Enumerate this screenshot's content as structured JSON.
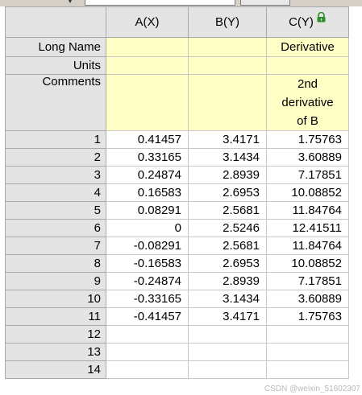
{
  "columns": [
    {
      "label": "A(X)"
    },
    {
      "label": "B(Y)"
    },
    {
      "label": "C(Y)"
    }
  ],
  "row_labels": {
    "long_name": "Long Name",
    "units": "Units",
    "comments": "Comments"
  },
  "meta": {
    "long_name": [
      "",
      "",
      "Derivative"
    ],
    "units": [
      "",
      "",
      ""
    ],
    "comments": [
      "",
      "",
      "2nd derivative of B"
    ]
  },
  "rows": [
    {
      "n": "1",
      "a": "0.41457",
      "b": "3.4171",
      "c": "1.75763"
    },
    {
      "n": "2",
      "a": "0.33165",
      "b": "3.1434",
      "c": "3.60889"
    },
    {
      "n": "3",
      "a": "0.24874",
      "b": "2.8939",
      "c": "7.17851"
    },
    {
      "n": "4",
      "a": "0.16583",
      "b": "2.6953",
      "c": "10.08852"
    },
    {
      "n": "5",
      "a": "0.08291",
      "b": "2.5681",
      "c": "11.84764"
    },
    {
      "n": "6",
      "a": "0",
      "b": "2.5246",
      "c": "12.41511"
    },
    {
      "n": "7",
      "a": "-0.08291",
      "b": "2.5681",
      "c": "11.84764"
    },
    {
      "n": "8",
      "a": "-0.16583",
      "b": "2.6953",
      "c": "10.08852"
    },
    {
      "n": "9",
      "a": "-0.24874",
      "b": "2.8939",
      "c": "7.17851"
    },
    {
      "n": "10",
      "a": "-0.33165",
      "b": "3.1434",
      "c": "3.60889"
    },
    {
      "n": "11",
      "a": "-0.41457",
      "b": "3.4171",
      "c": "1.75763"
    },
    {
      "n": "12",
      "a": "",
      "b": "",
      "c": ""
    },
    {
      "n": "13",
      "a": "",
      "b": "",
      "c": ""
    },
    {
      "n": "14",
      "a": "",
      "b": "",
      "c": ""
    }
  ],
  "icons": {
    "column_c": "lock-icon",
    "toolbar_dropdown": "chevron-down-icon"
  },
  "colors": {
    "header_bg": "#e4e4e4",
    "meta_bg": "#ffffc6",
    "lock_green": "#2f8f2f"
  },
  "watermark": "CSDN @weixin_51602307"
}
